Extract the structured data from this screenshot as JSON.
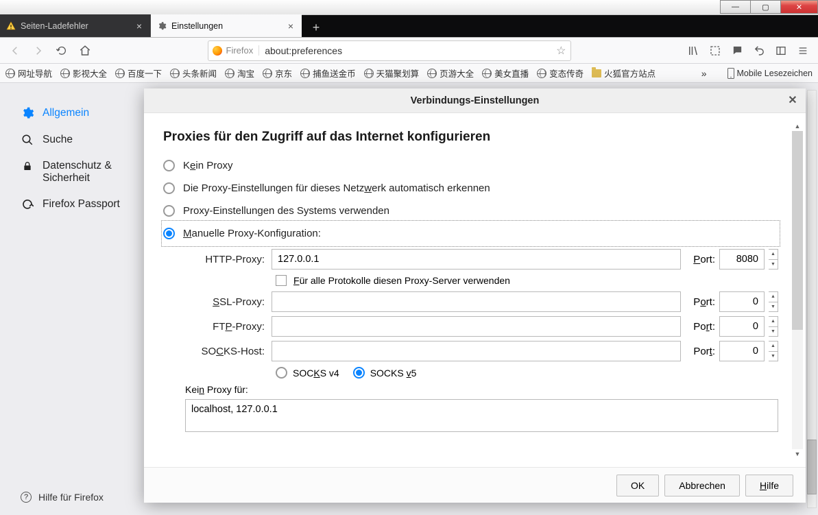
{
  "window": {
    "min": "—",
    "max": "▢",
    "close": "✕"
  },
  "tabs": {
    "inactive": {
      "title": "Seiten-Ladefehler"
    },
    "active": {
      "title": "Einstellungen"
    }
  },
  "urlbar": {
    "brand": "Firefox",
    "url": "about:preferences"
  },
  "bookmarks": {
    "items": [
      {
        "label": "网址导航"
      },
      {
        "label": "影视大全"
      },
      {
        "label": "百度一下"
      },
      {
        "label": "头条新闻"
      },
      {
        "label": "淘宝"
      },
      {
        "label": "京东"
      },
      {
        "label": "捕鱼送金币"
      },
      {
        "label": "天猫聚划算"
      },
      {
        "label": "页游大全"
      },
      {
        "label": "美女直播"
      },
      {
        "label": "变态传奇"
      },
      {
        "label": "火狐官方站点"
      }
    ],
    "mobile": "Mobile Lesezeichen"
  },
  "sidebar": {
    "general": "Allgemein",
    "search": "Suche",
    "privacy1": "Datenschutz &",
    "privacy2": "Sicherheit",
    "passport": "Firefox Passport",
    "help": "Hilfe für Firefox"
  },
  "dialog": {
    "title": "Verbindungs-Einstellungen",
    "heading": "Proxies für den Zugriff auf das Internet konfigurieren",
    "opt_no": "Kein Proxy",
    "opt_auto": "Die Proxy-Einstellungen für dieses Netzwerk automatisch erkennen",
    "opt_sys": "Proxy-Einstellungen des Systems verwenden",
    "opt_manual": "Manuelle Proxy-Konfiguration:",
    "http_label": "HTTP-Proxy:",
    "http_host": "127.0.0.1",
    "http_port": "8080",
    "port_label": "Port:",
    "same_label": "Für alle Protokolle diesen Proxy-Server verwenden",
    "ssl_label": "SSL-Proxy:",
    "ssl_host": "",
    "ssl_port": "0",
    "ftp_label": "FTP-Proxy:",
    "ftp_host": "",
    "ftp_port": "0",
    "socks_label": "SOCKS-Host:",
    "socks_host": "",
    "socks_port": "0",
    "socks_v4": "SOCKS v4",
    "socks_v5": "SOCKS v5",
    "noproxy_label": "Kein Proxy für:",
    "noproxy_value": "localhost, 127.0.0.1",
    "ok": "OK",
    "cancel": "Abbrechen",
    "help": "Hilfe"
  }
}
